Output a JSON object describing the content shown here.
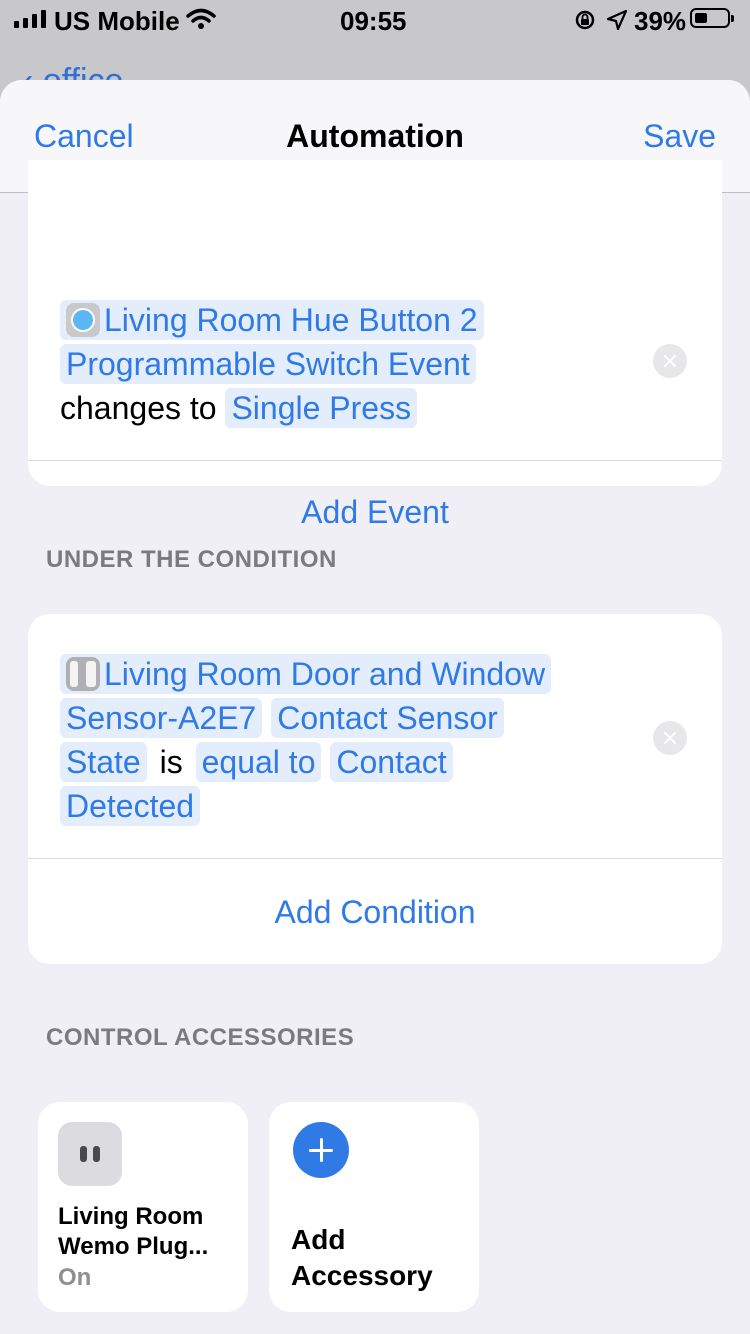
{
  "status_bar": {
    "carrier": "US Mobile",
    "time": "09:55",
    "battery_percent": "39%"
  },
  "behind": {
    "back_label": "office"
  },
  "nav": {
    "cancel_label": "Cancel",
    "title": "Automation",
    "save_label": "Save"
  },
  "event": {
    "device": "Living Room Hue Button 2",
    "characteristic": "Programmable Switch Event",
    "operator": "changes to",
    "value": "Single Press",
    "add_label": "Add Event"
  },
  "condition_section": {
    "header": "UNDER THE CONDITION",
    "device_line1": "Living Room Door and Window",
    "device_line2": "Sensor-A2E7",
    "characteristic_line1": "Contact Sensor",
    "characteristic_line2": "State",
    "operator_word": "is",
    "comparator": "equal to",
    "value_line1": "Contact",
    "value_line2": "Detected",
    "add_label": "Add Condition"
  },
  "accessories_section": {
    "header": "CONTROL ACCESSORIES",
    "tiles": [
      {
        "name": "Living Room Wemo Plug...",
        "status": "On"
      }
    ],
    "add_label": "Add Accessory"
  },
  "colors": {
    "accent": "#2f7ae5",
    "token_bg": "#e3edfb",
    "sheet_bg": "#f0eff5"
  }
}
